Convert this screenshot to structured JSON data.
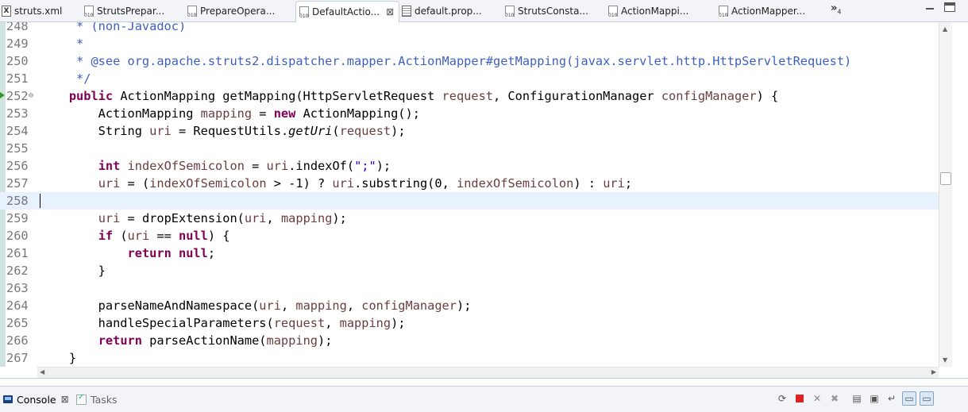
{
  "editor_tabs": [
    {
      "label": "struts.xml",
      "icon": "xml-file-icon",
      "active": false
    },
    {
      "label": "StrutsPrepar...",
      "icon": "class-file-icon",
      "active": false
    },
    {
      "label": "PrepareOpera...",
      "icon": "class-file-icon",
      "active": false
    },
    {
      "label": "DefaultActio...",
      "icon": "class-file-icon",
      "active": true,
      "close": "⊠"
    },
    {
      "label": "default.prop...",
      "icon": "properties-file-icon",
      "active": false
    },
    {
      "label": "StrutsConsta...",
      "icon": "class-file-icon",
      "active": false
    },
    {
      "label": "ActionMappi...",
      "icon": "class-file-icon",
      "active": false
    },
    {
      "label": "ActionMapper...",
      "icon": "class-file-icon",
      "active": false
    }
  ],
  "overflow": {
    "symbol": "»",
    "count": "4"
  },
  "code_lines": [
    {
      "num": "248",
      "html": "<span class='cm'>     * (non-Javadoc)</span>"
    },
    {
      "num": "249",
      "html": "<span class='cm'>     *</span>"
    },
    {
      "num": "250",
      "html": "<span class='cm'>     * @see org.apache.struts2.dispatcher.mapper.ActionMapper#getMapping(javax.servlet.http.HttpServletRequest)</span>"
    },
    {
      "num": "251",
      "html": "<span class='cm'>     */</span>"
    },
    {
      "num": "252",
      "html": "<span class='kw'>public</span> ActionMapping getMapping(HttpServletRequest <span class='vr'>request</span>, ConfigurationManager <span class='vr'>configManager</span>) {",
      "indent": "    ",
      "fold": "⊖",
      "marker": true
    },
    {
      "num": "253",
      "html": "        ActionMapping <span class='vr'>mapping</span> = <span class='kw'>new</span> ActionMapping();"
    },
    {
      "num": "254",
      "html": "        String <span class='vr'>uri</span> = RequestUtils.<span class='it'>getUri</span>(<span class='vr'>request</span>);"
    },
    {
      "num": "255",
      "html": ""
    },
    {
      "num": "256",
      "html": "        <span class='kw'>int</span> <span class='vr'>indexOfSemicolon</span> = <span class='vr'>uri</span>.indexOf(<span class='st'>\";\"</span>);"
    },
    {
      "num": "257",
      "html": "        <span class='vr'>uri</span> = (<span class='vr'>indexOfSemicolon</span> &gt; -1) ? <span class='vr'>uri</span>.substring(0, <span class='vr'>indexOfSemicolon</span>) : <span class='vr'>uri</span>;"
    },
    {
      "num": "258",
      "html": "",
      "current": true
    },
    {
      "num": "259",
      "html": "        <span class='vr'>uri</span> = dropExtension(<span class='vr'>uri</span>, <span class='vr'>mapping</span>);"
    },
    {
      "num": "260",
      "html": "        <span class='kw'>if</span> (<span class='vr'>uri</span> == <span class='kw'>null</span>) {"
    },
    {
      "num": "261",
      "html": "            <span class='kw'>return</span> <span class='kw'>null</span>;"
    },
    {
      "num": "262",
      "html": "        }"
    },
    {
      "num": "263",
      "html": ""
    },
    {
      "num": "264",
      "html": "        parseNameAndNamespace(<span class='vr'>uri</span>, <span class='vr'>mapping</span>, <span class='vr'>configManager</span>);"
    },
    {
      "num": "265",
      "html": "        handleSpecialParameters(<span class='vr'>request</span>, <span class='vr'>mapping</span>);"
    },
    {
      "num": "266",
      "html": "        <span class='kw'>return</span> parseActionName(<span class='vr'>mapping</span>);"
    },
    {
      "num": "267",
      "html": "    }"
    }
  ],
  "bottom_tabs": {
    "console_label": "Console",
    "console_close": "⊠",
    "tasks_label": "Tasks"
  },
  "toolbar_icons": [
    "relaunch-icon",
    "terminate-icon",
    "remove-launch-icon",
    "remove-all-terminated-icon",
    "clear-console-icon",
    "scroll-lock-icon",
    "word-wrap-icon",
    "show-console-on-output-icon",
    "show-console-on-error-icon"
  ],
  "colors": {
    "keyword": "#7f0055",
    "comment": "#3f5fbf",
    "variable": "#6a3e3e",
    "string": "#2a00ff",
    "current_line": "#e8f2fe"
  }
}
